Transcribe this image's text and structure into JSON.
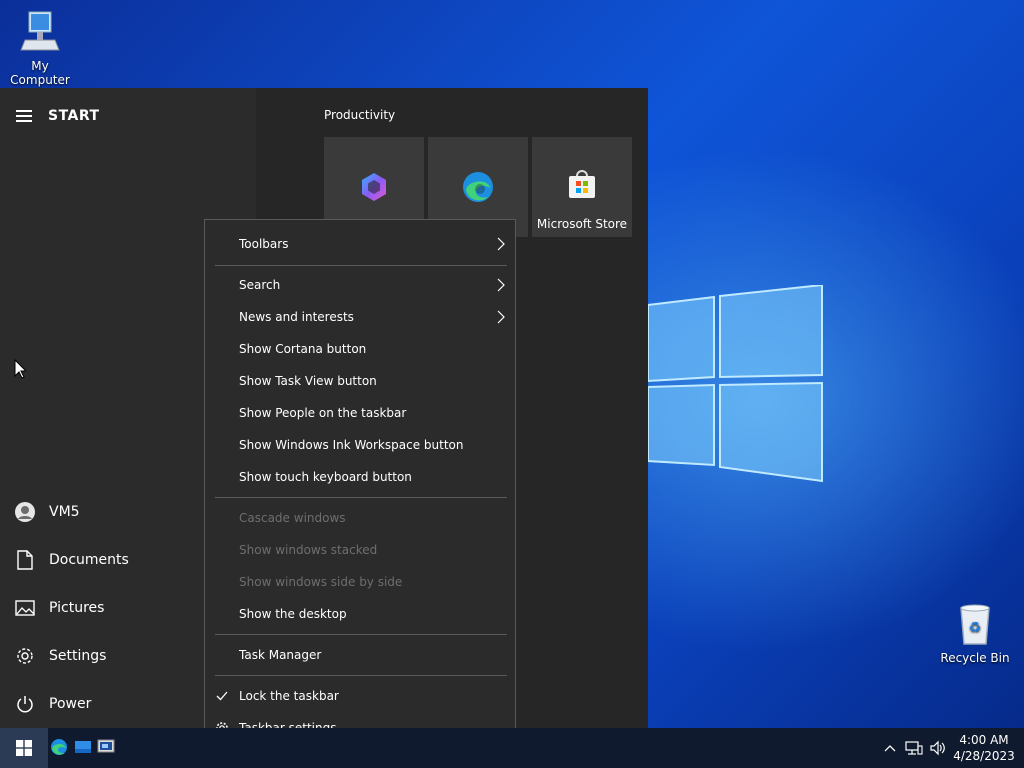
{
  "desktop": {
    "icons": [
      {
        "label": "My Computer"
      },
      {
        "label": "Recycle Bin"
      }
    ]
  },
  "start_menu": {
    "title": "START",
    "left_items": [
      {
        "label": "VM5",
        "icon": "user-icon"
      },
      {
        "label": "Documents",
        "icon": "document-icon"
      },
      {
        "label": "Pictures",
        "icon": "pictures-icon"
      },
      {
        "label": "Settings",
        "icon": "gear-icon"
      },
      {
        "label": "Power",
        "icon": "power-icon"
      }
    ],
    "group_title": "Productivity",
    "tiles": [
      {
        "label": "",
        "icon": "office-icon"
      },
      {
        "label": "",
        "icon": "edge-icon"
      },
      {
        "label": "Microsoft Store",
        "icon": "store-icon"
      }
    ]
  },
  "context_menu": {
    "items": [
      {
        "label": "Toolbars",
        "submenu": true
      },
      {
        "label": "Search",
        "submenu": true
      },
      {
        "label": "News and interests",
        "submenu": true
      },
      {
        "label": "Show Cortana button"
      },
      {
        "label": "Show Task View button"
      },
      {
        "label": "Show People on the taskbar"
      },
      {
        "label": "Show Windows Ink Workspace button"
      },
      {
        "label": "Show touch keyboard button"
      },
      {
        "label": "Cascade windows",
        "disabled": true
      },
      {
        "label": "Show windows stacked",
        "disabled": true
      },
      {
        "label": "Show windows side by side",
        "disabled": true
      },
      {
        "label": "Show the desktop"
      },
      {
        "label": "Task Manager"
      },
      {
        "label": "Lock the taskbar",
        "checked": true
      },
      {
        "label": "Taskbar settings",
        "icon": "gear-icon"
      }
    ]
  },
  "taskbar": {
    "pinned": [
      "edge-icon",
      "explorer-icon",
      "remote-desktop-icon"
    ],
    "clock": {
      "time": "4:00 AM",
      "date": "4/28/2023"
    },
    "tray_icons": [
      "chevron-up-icon",
      "network-icon",
      "volume-icon"
    ]
  },
  "colors": {
    "accent": "#0f55d8",
    "menu_bg": "#2b2b2b",
    "taskbar_bg": "#0f1a2e"
  }
}
